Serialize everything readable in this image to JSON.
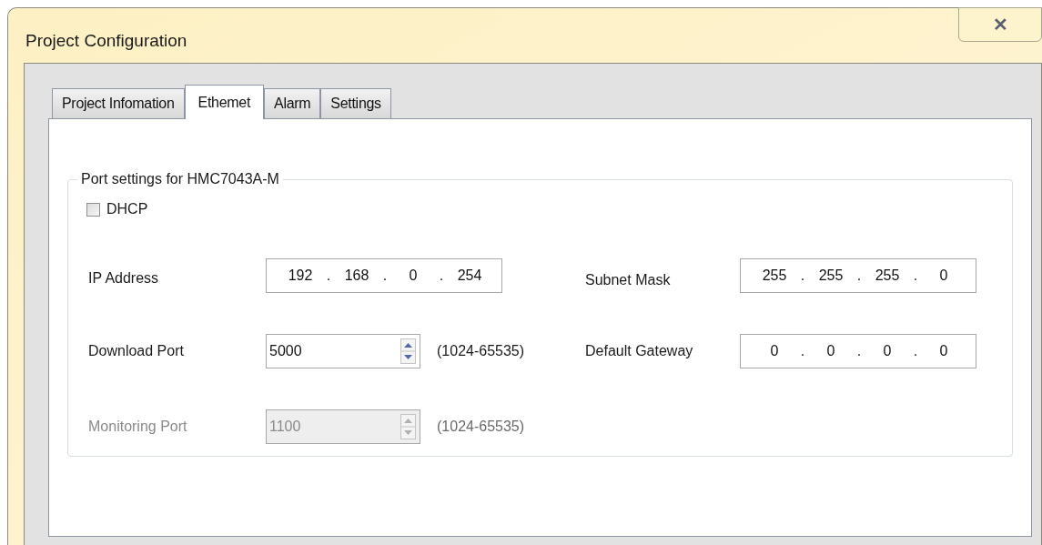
{
  "window": {
    "title": "Project Configuration",
    "close": "✕"
  },
  "tabs": [
    {
      "label": "Project Infomation",
      "selected": false
    },
    {
      "label": "Ethemet",
      "selected": true
    },
    {
      "label": "Alarm",
      "selected": false
    },
    {
      "label": "Settings",
      "selected": false
    }
  ],
  "group": {
    "title": "Port settings for HMC7043A-M",
    "dhcp": {
      "label": "DHCP",
      "checked": false
    },
    "ip_address": {
      "label": "IP Address",
      "separator": ".",
      "octets": [
        "192",
        "168",
        "0",
        "254"
      ]
    },
    "subnet_mask": {
      "label": "Subnet Mask",
      "separator": ".",
      "octets": [
        "255",
        "255",
        "255",
        "0"
      ]
    },
    "download_port": {
      "label": "Download Port",
      "value": "5000",
      "range": "(1024-65535)",
      "disabled": false
    },
    "default_gateway": {
      "label": "Default Gateway",
      "separator": ".",
      "octets": [
        "0",
        "0",
        "0",
        "0"
      ]
    },
    "monitoring_port": {
      "label": "Monitoring Port",
      "value": "1100",
      "range": "(1024-65535)",
      "disabled": true
    }
  }
}
